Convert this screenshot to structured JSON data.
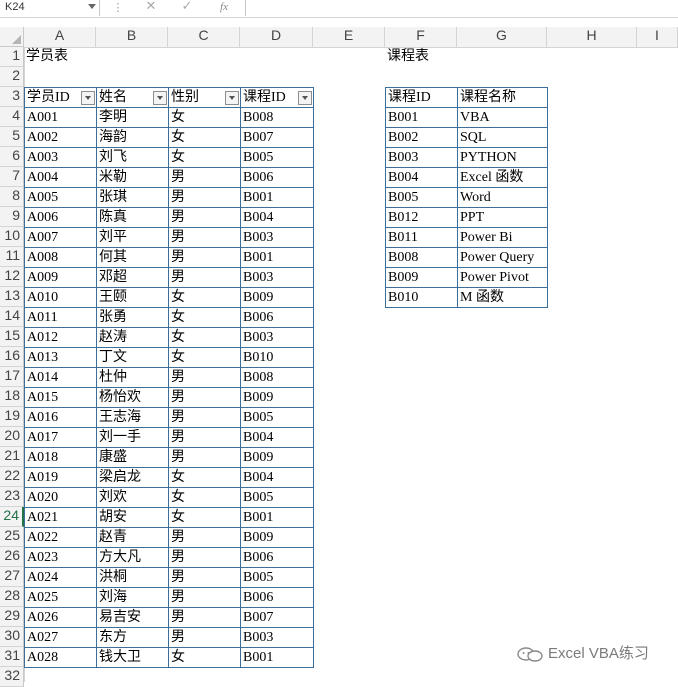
{
  "formula_bar": {
    "name_box": "K24",
    "fx_label": "fx",
    "cancel_glyph": "✕",
    "enter_glyph": "✓",
    "separator": "⋮"
  },
  "columns": [
    "A",
    "B",
    "C",
    "D",
    "E",
    "F",
    "G",
    "H",
    "I"
  ],
  "rows": [
    "1",
    "2",
    "3",
    "4",
    "5",
    "6",
    "7",
    "8",
    "9",
    "10",
    "11",
    "12",
    "13",
    "14",
    "15",
    "16",
    "17",
    "18",
    "19",
    "20",
    "21",
    "22",
    "23",
    "24",
    "25",
    "26",
    "27",
    "28",
    "29",
    "30",
    "31",
    "32"
  ],
  "selected_row": "24",
  "student_table": {
    "title": "学员表",
    "headers": [
      "学员ID",
      "姓名",
      "性别",
      "课程ID"
    ],
    "rows": [
      [
        "A001",
        "李明",
        "女",
        "B008"
      ],
      [
        "A002",
        "海韵",
        "女",
        "B007"
      ],
      [
        "A003",
        "刘飞",
        "女",
        "B005"
      ],
      [
        "A004",
        "米勒",
        "男",
        "B006"
      ],
      [
        "A005",
        "张琪",
        "男",
        "B001"
      ],
      [
        "A006",
        "陈真",
        "男",
        "B004"
      ],
      [
        "A007",
        "刘平",
        "男",
        "B003"
      ],
      [
        "A008",
        "何其",
        "男",
        "B001"
      ],
      [
        "A009",
        "邓超",
        "男",
        "B003"
      ],
      [
        "A010",
        "王颐",
        "女",
        "B009"
      ],
      [
        "A011",
        "张勇",
        "女",
        "B006"
      ],
      [
        "A012",
        "赵涛",
        "女",
        "B003"
      ],
      [
        "A013",
        "丁文",
        "女",
        "B010"
      ],
      [
        "A014",
        "杜仲",
        "男",
        "B008"
      ],
      [
        "A015",
        "杨怡欢",
        "男",
        "B009"
      ],
      [
        "A016",
        "王志海",
        "男",
        "B005"
      ],
      [
        "A017",
        "刘一手",
        "男",
        "B004"
      ],
      [
        "A018",
        "康盛",
        "男",
        "B009"
      ],
      [
        "A019",
        "梁启龙",
        "女",
        "B004"
      ],
      [
        "A020",
        "刘欢",
        "女",
        "B005"
      ],
      [
        "A021",
        "胡安",
        "女",
        "B001"
      ],
      [
        "A022",
        "赵青",
        "男",
        "B009"
      ],
      [
        "A023",
        "方大凡",
        "男",
        "B006"
      ],
      [
        "A024",
        "洪桐",
        "男",
        "B005"
      ],
      [
        "A025",
        "刘海",
        "男",
        "B006"
      ],
      [
        "A026",
        "易吉安",
        "男",
        "B007"
      ],
      [
        "A027",
        "东方",
        "男",
        "B003"
      ],
      [
        "A028",
        "钱大卫",
        "女",
        "B001"
      ]
    ]
  },
  "course_table": {
    "title": "课程表",
    "headers": [
      "课程ID",
      "课程名称"
    ],
    "rows": [
      [
        "B001",
        "VBA"
      ],
      [
        "B002",
        "SQL"
      ],
      [
        "B003",
        "PYTHON"
      ],
      [
        "B004",
        "Excel 函数"
      ],
      [
        "B005",
        "Word"
      ],
      [
        "B012",
        "PPT"
      ],
      [
        "B011",
        "Power Bi"
      ],
      [
        "B008",
        "Power Query"
      ],
      [
        "B009",
        "Power Pivot"
      ],
      [
        "B010",
        "M 函数"
      ]
    ]
  },
  "watermark": {
    "text": "Excel VBA练习",
    "icon": "wechat-icon"
  },
  "colors": {
    "table_border": "#3b6e9b",
    "grid_line": "#d4d4d4",
    "header_bg": "#f3f3f3",
    "selection": "#217346"
  }
}
